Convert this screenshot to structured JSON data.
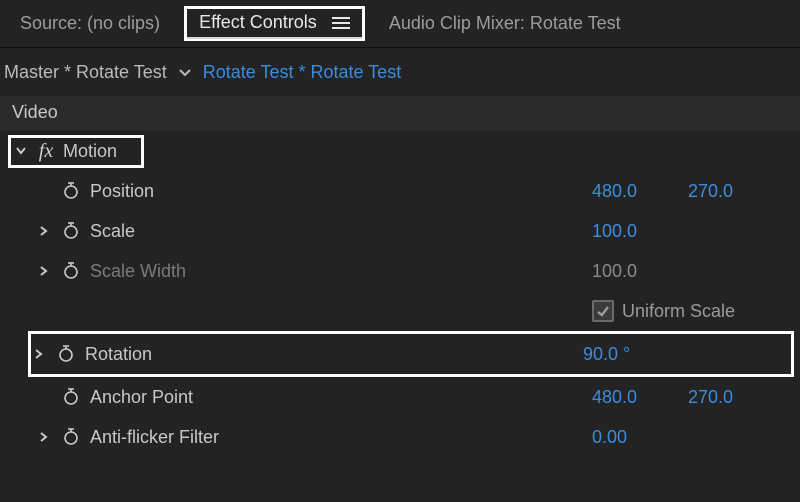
{
  "tabs": {
    "source": "Source: (no clips)",
    "effect_controls": "Effect Controls",
    "audio_mixer": "Audio Clip Mixer: Rotate Test"
  },
  "breadcrumb": {
    "master": "Master * Rotate Test",
    "clip": "Rotate Test * Rotate Test"
  },
  "section": {
    "video": "Video"
  },
  "motion": {
    "label": "Motion",
    "fx": "fx",
    "position": {
      "label": "Position",
      "x": "480.0",
      "y": "270.0"
    },
    "scale": {
      "label": "Scale",
      "value": "100.0"
    },
    "scale_width": {
      "label": "Scale Width",
      "value": "100.0"
    },
    "uniform_scale": {
      "label": "Uniform Scale",
      "checked": true
    },
    "rotation": {
      "label": "Rotation",
      "value": "90.0 °"
    },
    "anchor_point": {
      "label": "Anchor Point",
      "x": "480.0",
      "y": "270.0"
    },
    "anti_flicker": {
      "label": "Anti-flicker Filter",
      "value": "0.00"
    }
  }
}
